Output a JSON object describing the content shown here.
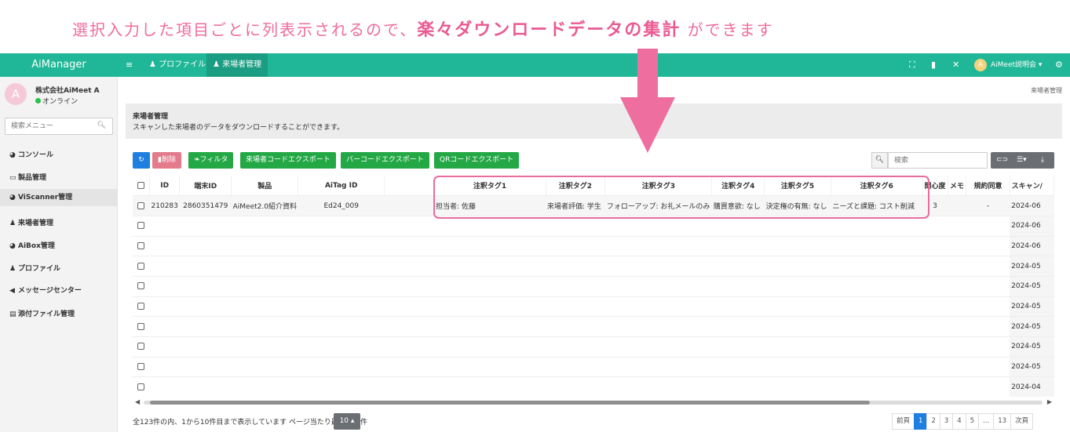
{
  "banner": {
    "prefix": "選択入力した項目ごとに列表示されるので、",
    "emphasis": "楽々ダウンロードデータの集計",
    "suffix": "ができます"
  },
  "topbar": {
    "brand": "AiManager",
    "nav": [
      {
        "label": "プロファイル"
      },
      {
        "label": "来場者管理"
      }
    ],
    "user": "AiMeet説明会",
    "avatar_initial": "A"
  },
  "sidebar": {
    "company": "株式会社AiMeet A",
    "status": "オンライン",
    "avatar_initial": "A",
    "search_placeholder": "検索メニュー",
    "items": [
      {
        "label": "コンソール",
        "icon": "dashboard-icon"
      },
      {
        "label": "製品管理",
        "icon": "box-icon"
      },
      {
        "label": "ViScanner管理",
        "icon": "dashboard-icon"
      },
      {
        "label": "来場者管理",
        "icon": "users-icon"
      },
      {
        "label": "AiBox管理",
        "icon": "dashboard-icon"
      },
      {
        "label": "プロファイル",
        "icon": "user-icon"
      },
      {
        "label": "メッセージセンター",
        "icon": "megaphone-icon"
      },
      {
        "label": "添付ファイル管理",
        "icon": "file-icon"
      }
    ]
  },
  "breadcrumb": "来場者管理",
  "page": {
    "title": "来場者管理",
    "description": "スキャンした来場者のデータをダウンロードすることができます。"
  },
  "toolbar": {
    "delete": "削除",
    "filter": "フィルタ",
    "export_visitor": "来場者コードエクスポート",
    "export_barcode": "バーコードエクスポート",
    "export_qr": "QRコードエクスポート",
    "search_placeholder": "検索"
  },
  "table": {
    "headers": {
      "id": "ID",
      "device": "端末ID",
      "product": "製品",
      "aitag": "AiTag ID",
      "tag1": "注釈タグ1",
      "tag2": "注釈タグ2",
      "tag3": "注釈タグ3",
      "tag4": "注釈タグ4",
      "tag5": "注釈タグ5",
      "tag6": "注釈タグ6",
      "interest": "関心度",
      "memo": "メモ",
      "consent": "規約同意",
      "scan": "スキャン/"
    },
    "row": {
      "id": "210283",
      "device": "2860351479",
      "product": "AiMeet2.0紹介資料",
      "aitag": "Ed24_009",
      "tag1": "担当者: 佐藤",
      "tag2": "来場者評価: 学生",
      "tag3": "フォローアップ: お礼メールのみ",
      "tag4": "購買意欲: なし",
      "tag5": "決定権の有無: なし",
      "tag6": "ニーズと課題: コスト削減",
      "interest": "3",
      "memo": "",
      "consent": "-",
      "scan": "2024-06"
    },
    "scan_col": [
      "2024-06",
      "2024-06",
      "2024-06",
      "2024-05",
      "2024-05",
      "2024-05",
      "2024-05",
      "2024-05",
      "2024-05",
      "2024-04"
    ]
  },
  "footer": {
    "summary": "全123件の内、1から10件目まで表示しています ページ当たり最大",
    "per_page": "10",
    "suffix": "件"
  },
  "pagination": {
    "prev": "前頁",
    "pages": [
      "1",
      "2",
      "3",
      "4",
      "5",
      "...",
      "13"
    ],
    "next": "次頁"
  },
  "colors": {
    "accent": "#1fb797",
    "highlight": "#ea6c9d",
    "primary": "#1f7fe0",
    "success": "#23a845",
    "danger": "#e37b8d"
  }
}
